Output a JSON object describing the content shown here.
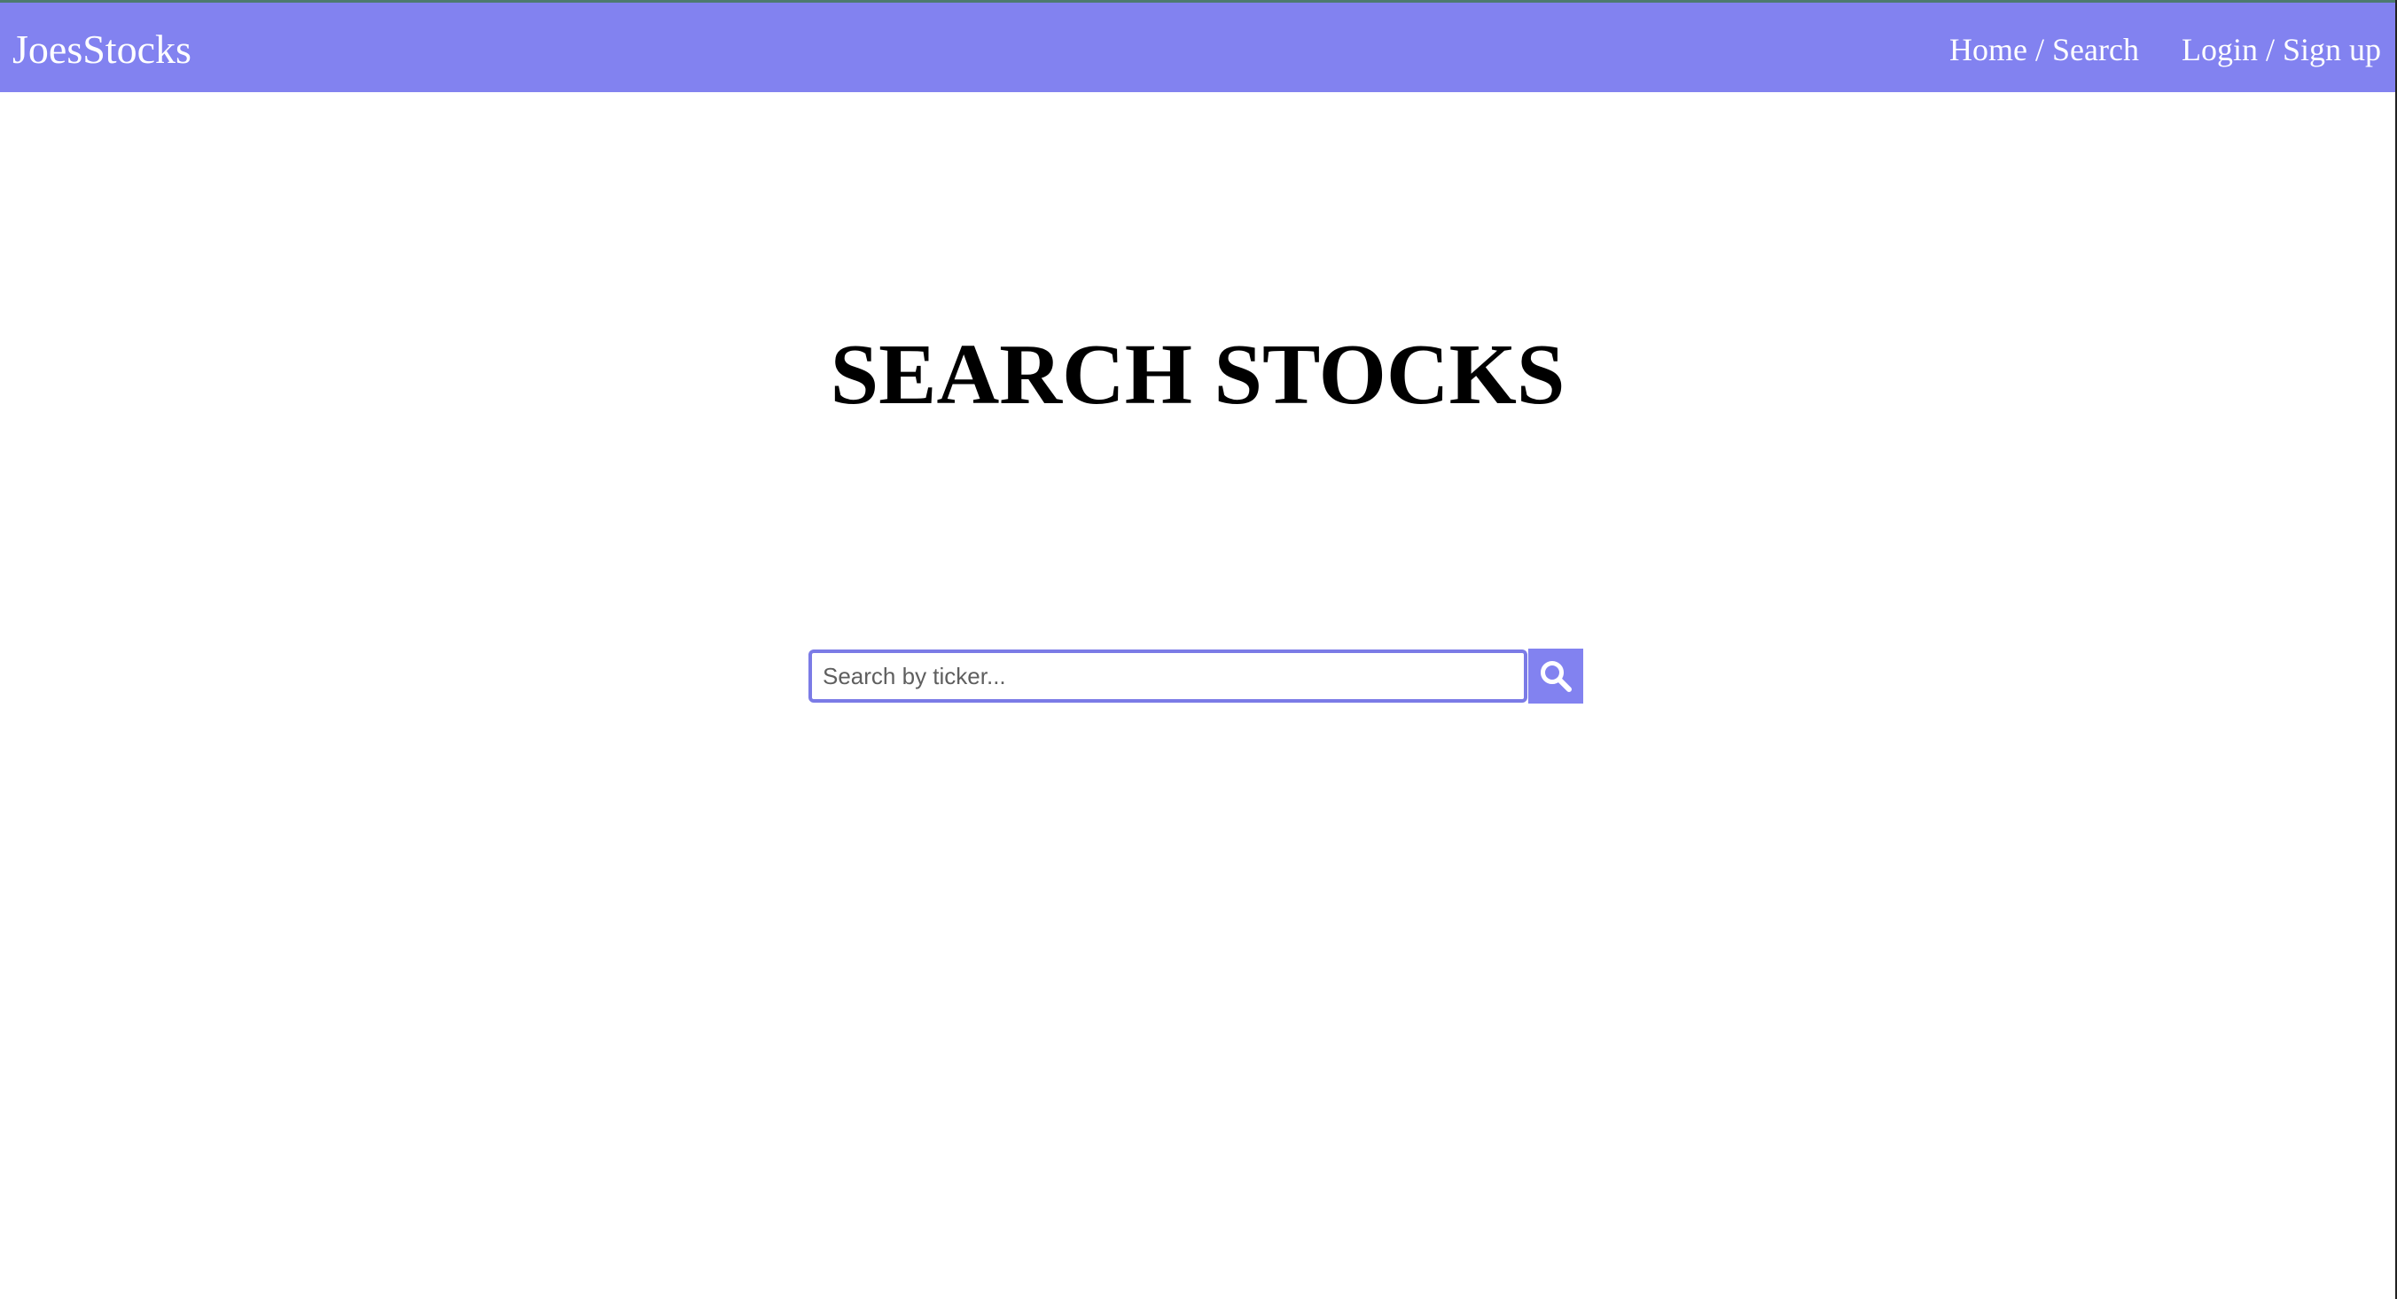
{
  "colors": {
    "accent": "#8282f0",
    "nav_text": "#ffffff",
    "input_border": "#7b7be6",
    "title_text": "#000000",
    "page_background": "#ffffff"
  },
  "navbar": {
    "brand": "JoesStocks",
    "links": [
      {
        "label": "Home / Search"
      },
      {
        "label": "Login / Sign up"
      }
    ]
  },
  "main": {
    "title": "SEARCH STOCKS",
    "search": {
      "placeholder": "Search by ticker...",
      "value": "",
      "button_icon": "search-icon"
    }
  }
}
